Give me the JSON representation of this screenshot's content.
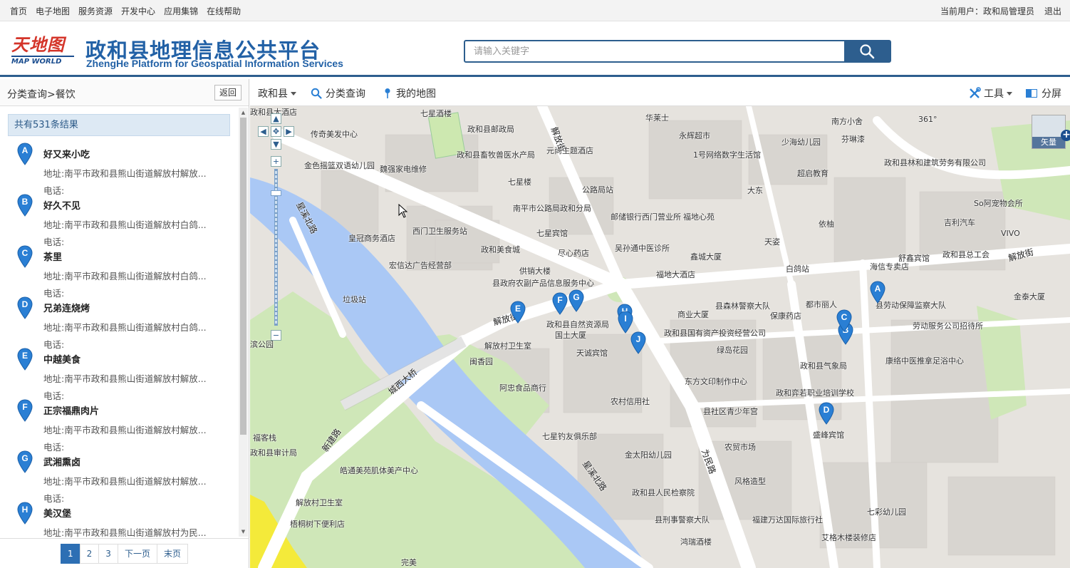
{
  "topnav": {
    "links": [
      "首页",
      "电子地图",
      "服务资源",
      "开发中心",
      "应用集锦",
      "在线帮助"
    ],
    "user_label": "当前用户：",
    "user_name": "政和局管理员",
    "logout": "退出"
  },
  "header": {
    "logo_cn": "天地图",
    "logo_en": "MAP WORLD",
    "title_cn": "政和县地理信息公共平台",
    "title_en": "ZhengHe Platform for Geospatial Information Services",
    "search_placeholder": "请输入关键字"
  },
  "left": {
    "breadcrumb": "分类查询>餐饮",
    "back": "返回",
    "result_count": "共有531条结果",
    "tel_label": "电话:",
    "items": [
      {
        "letter": "A",
        "name": "好又来小吃",
        "addr": "地址:南平市政和县熊山街道解放村解放..."
      },
      {
        "letter": "B",
        "name": "好久不见",
        "addr": "地址:南平市政和县熊山街道解放村白鸽..."
      },
      {
        "letter": "C",
        "name": "茶里",
        "addr": "地址:南平市政和县熊山街道解放村白鸽..."
      },
      {
        "letter": "D",
        "name": "兄弟连烧烤",
        "addr": "地址:南平市政和县熊山街道解放村白鸽..."
      },
      {
        "letter": "E",
        "name": "中越美食",
        "addr": "地址:南平市政和县熊山街道解放村解放..."
      },
      {
        "letter": "F",
        "name": "正宗福鼎肉片",
        "addr": "地址:南平市政和县熊山街道解放村解放..."
      },
      {
        "letter": "G",
        "name": "武湘熏卤",
        "addr": "地址:南平市政和县熊山街道解放村解放..."
      },
      {
        "letter": "H",
        "name": "美汉堡",
        "addr": "地址:南平市政和县熊山街道解放村为民..."
      }
    ],
    "pager": [
      "1",
      "2",
      "3",
      "下一页",
      "末页"
    ]
  },
  "maptool": {
    "region": "政和县",
    "category": "分类查询",
    "mymap": "我的地图",
    "tools": "工具",
    "split": "分屏"
  },
  "map": {
    "layer_label": "矢量",
    "colors": {
      "pin": "#2a7fd4",
      "river": "#aac8f5",
      "green": "#cfe7b8",
      "header_blue": "#2d5e8e"
    },
    "pins": [
      {
        "letter": "A"
      },
      {
        "letter": "B"
      },
      {
        "letter": "C"
      },
      {
        "letter": "D"
      },
      {
        "letter": "E"
      },
      {
        "letter": "F"
      },
      {
        "letter": "G"
      },
      {
        "letter": "H"
      },
      {
        "letter": "I"
      },
      {
        "letter": "J"
      }
    ],
    "labels": [
      "七星酒楼",
      "政和县邮政局",
      "传奇美发中心",
      "政和县畜牧兽医水产局",
      "魏强家电维修",
      "金色摇篮双语幼儿园",
      "七星楼",
      "元尚主题酒店",
      "公路局站",
      "南平市公路局政和分局",
      "七星宾馆",
      "邮储银行西门营业所",
      "福地心苑",
      "吴孙通中医诊所",
      "皇冠商务酒店",
      "西门卫生服务站",
      "政和美食城",
      "尽心药店",
      "宏信达广告经营部",
      "供销大楼",
      "县政府农副产品信息服务中心",
      "垃圾站",
      "福地大酒店",
      "鑫城大厦",
      "白鸽站",
      "政和县自然资源局",
      "国土大厦",
      "天诚宾馆",
      "解放村卫生室",
      "闽香园",
      "阿忠食品商行",
      "县森林警察大队",
      "保康药店",
      "商业大厦",
      "政和县国有资产投资经营公司",
      "绿岛花园",
      "东方文印制作中心",
      "农村信用社",
      "县社区青少年宫",
      "七星钓友俱乐部",
      "金太阳幼儿园",
      "农贸市场",
      "风格造型",
      "政和县人民检察院",
      "县刑事警察大队",
      "福建万达国际旅行社",
      "鸿瑞酒楼",
      "艾格木楼装修店",
      "七彩幼儿园",
      "依柚",
      "天姿",
      "大东",
      "1号网络数字生活馆",
      "永辉超市",
      "华莱士",
      "361°",
      "少海幼儿园",
      "南方小舍",
      "芬琳漆",
      "超启教育",
      "政和县林和建筑劳务有限公司",
      "So阿宠物会所",
      "吉利汽车",
      "VIVO",
      "政和县总工会",
      "舒鑫宾馆",
      "海信专卖店",
      "金泰大厦",
      "县劳动保障监察大队",
      "劳动服务公司招待所",
      "康络中医推拿足浴中心",
      "政和县气象局",
      "政和弈若职业培训学校",
      "盛峰宾馆",
      "都市丽人",
      "福客栈",
      "政和县审计局",
      "皓通美苑肌体美产中心",
      "解放村卫生室",
      "梧桐树下便利店",
      "完美",
      "滨公园",
      "政和县大酒店"
    ],
    "roads": [
      "解放街",
      "星溪北路",
      "解放街",
      "城西大桥",
      "新建路",
      "星溪北路",
      "为民路",
      "解放街"
    ]
  }
}
